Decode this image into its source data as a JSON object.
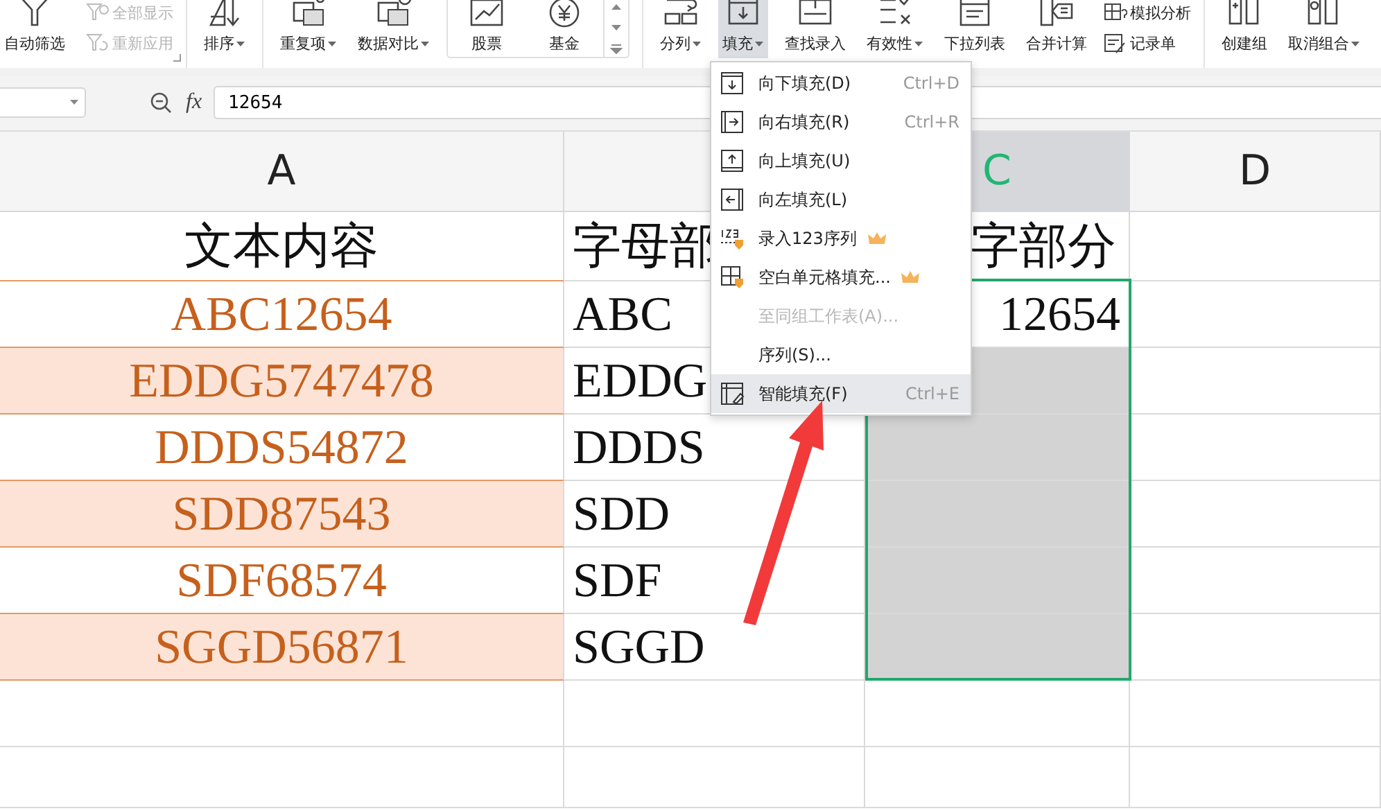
{
  "ribbon": {
    "groups": [
      {
        "items": [
          {
            "kind": "big",
            "label": "自动筛选",
            "dropdown": false,
            "active": false
          },
          {
            "kind": "stack",
            "entries": [
              {
                "label": "全部显示",
                "disabled": true
              },
              {
                "label": "重新应用",
                "disabled": true
              }
            ]
          }
        ]
      },
      {
        "items": [
          {
            "kind": "big",
            "label": "排序",
            "dropdown": true,
            "active": false
          }
        ]
      },
      {
        "items": [
          {
            "kind": "big",
            "label": "重复项",
            "dropdown": true,
            "active": false
          },
          {
            "kind": "big",
            "label": "数据对比",
            "dropdown": true,
            "active": false
          },
          {
            "kind": "gallery",
            "entries": [
              {
                "label": "股票"
              },
              {
                "label": "基金"
              }
            ]
          }
        ]
      },
      {
        "items": [
          {
            "kind": "big",
            "label": "分列",
            "dropdown": true,
            "active": false
          },
          {
            "kind": "big",
            "label": "填充",
            "dropdown": true,
            "active": true
          },
          {
            "kind": "big",
            "label": "查找录入",
            "dropdown": false,
            "active": false
          },
          {
            "kind": "big",
            "label": "有效性",
            "dropdown": true,
            "active": false
          },
          {
            "kind": "big",
            "label": "下拉列表",
            "dropdown": false,
            "active": false
          },
          {
            "kind": "big",
            "label": "合并计算",
            "dropdown": false,
            "active": false
          },
          {
            "kind": "stack",
            "entries": [
              {
                "label": "模拟分析",
                "disabled": false
              },
              {
                "label": "记录单",
                "disabled": false
              }
            ]
          }
        ]
      },
      {
        "items": [
          {
            "kind": "big",
            "label": "创建组",
            "dropdown": false,
            "active": false
          },
          {
            "kind": "big",
            "label": "取消组合",
            "dropdown": true,
            "active": false
          }
        ]
      }
    ]
  },
  "formula_bar": {
    "name_box": {
      "dropdown": true
    },
    "fx": "fx",
    "value": "12654"
  },
  "sheet": {
    "columns": [
      {
        "label": "A",
        "selected": false
      },
      {
        "selected": false
      },
      {
        "label": "C",
        "selected": true
      },
      {
        "label": "D",
        "selected": false
      }
    ],
    "rows": [
      {
        "cells": [
          {
            "text": "文本内容",
            "kind": "header",
            "highlighted": false
          },
          {
            "text": "字母部",
            "kind": "plain",
            "selected": false
          },
          {
            "text": "字部分",
            "kind": "partial",
            "selected": false
          },
          {
            "selected": false
          }
        ]
      },
      {
        "cells": [
          {
            "text": "ABC12654",
            "kind": "source",
            "highlighted": false
          },
          {
            "text": "ABC",
            "kind": "plain",
            "selected": false
          },
          {
            "text": "12654",
            "kind": "number",
            "active": true
          },
          {
            "selected": false
          }
        ]
      },
      {
        "cells": [
          {
            "text": "EDDG5747478",
            "kind": "source",
            "highlighted": true
          },
          {
            "text": "EDDG",
            "kind": "plain",
            "selected": false
          },
          {
            "kind": "plain",
            "selected": true
          },
          {
            "selected": false
          }
        ]
      },
      {
        "cells": [
          {
            "text": "DDDS54872",
            "kind": "source",
            "highlighted": false
          },
          {
            "text": "DDDS",
            "kind": "plain",
            "selected": false
          },
          {
            "kind": "plain",
            "selected": true
          },
          {
            "selected": false
          }
        ]
      },
      {
        "cells": [
          {
            "text": "SDD87543",
            "kind": "source",
            "highlighted": true
          },
          {
            "text": "SDD",
            "kind": "plain",
            "selected": false
          },
          {
            "kind": "plain",
            "selected": true
          },
          {
            "selected": false
          }
        ]
      },
      {
        "cells": [
          {
            "text": "SDF68574",
            "kind": "source",
            "highlighted": false
          },
          {
            "text": "SDF",
            "kind": "plain",
            "selected": false
          },
          {
            "kind": "plain",
            "selected": true
          },
          {
            "selected": false
          }
        ]
      },
      {
        "cells": [
          {
            "text": "SGGD56871",
            "kind": "source",
            "highlighted": true
          },
          {
            "text": "SGGD",
            "kind": "plain",
            "selected": false
          },
          {
            "kind": "plain",
            "selected": true
          },
          {
            "selected": false
          }
        ]
      },
      {
        "cells": [
          {
            "kind": "empty",
            "highlighted": false
          },
          {
            "selected": false
          },
          {
            "selected": false
          },
          {
            "selected": false
          }
        ]
      },
      {
        "cells": [
          {
            "kind": "empty",
            "highlighted": false
          },
          {
            "selected": false
          },
          {
            "selected": false
          },
          {
            "selected": false
          }
        ]
      }
    ]
  },
  "fill_menu": {
    "items": [
      {
        "label": "向下填充(D)",
        "shortcut": "Ctrl+D",
        "disabled": false,
        "premium": false,
        "selected": false
      },
      {
        "label": "向右填充(R)",
        "shortcut": "Ctrl+R",
        "disabled": false,
        "premium": false,
        "selected": false
      },
      {
        "label": "向上填充(U)",
        "disabled": false,
        "premium": false,
        "selected": false
      },
      {
        "label": "向左填充(L)",
        "disabled": false,
        "premium": false,
        "selected": false
      },
      {
        "label": "录入123序列",
        "disabled": false,
        "premium": true,
        "selected": false
      },
      {
        "label": "空白单元格填充...",
        "disabled": false,
        "premium": true,
        "selected": false
      },
      {
        "label": "至同组工作表(A)...",
        "disabled": true,
        "premium": false,
        "selected": false
      },
      {
        "label": "序列(S)...",
        "disabled": false,
        "premium": false,
        "selected": false
      },
      {
        "label": "智能填充(F)",
        "shortcut": "Ctrl+E",
        "disabled": false,
        "premium": false,
        "selected": true
      }
    ]
  },
  "annotation": {
    "kind": "arrow"
  }
}
